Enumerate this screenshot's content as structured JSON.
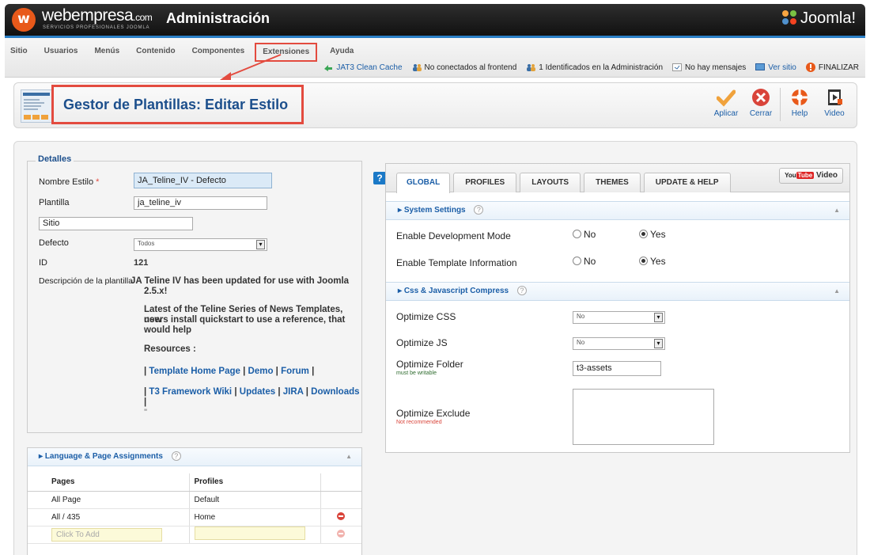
{
  "header": {
    "brand_name": "webempresa",
    "brand_domain": ".com",
    "brand_tagline": "SERVICIOS PROFESIONALES JOOMLA",
    "admin_title": "Administración",
    "joomla_logo": "Joomla!"
  },
  "menu": {
    "items": [
      "Sitio",
      "Usuarios",
      "Menús",
      "Contenido",
      "Componentes",
      "Extensiones",
      "Ayuda"
    ]
  },
  "status": {
    "cache": "JAT3 Clean Cache",
    "frontend": "No conectados al frontend",
    "admin": "1 Identificados en la Administración",
    "messages": "No hay mensajes",
    "view_site": "Ver sitio",
    "logout": "FINALIZAR"
  },
  "toolbar": {
    "title": "Gestor de Plantillas: Editar Estilo",
    "apply": "Aplicar",
    "close": "Cerrar",
    "help": "Help",
    "video": "Video"
  },
  "details": {
    "legend": "Detalles",
    "style_name_label": "Nombre Estilo",
    "required_mark": "*",
    "style_name_value": "JA_Teline_IV - Defecto",
    "template_label": "Plantilla",
    "template_value": "ja_teline_iv",
    "site_value": "Sitio",
    "default_label": "Defecto",
    "default_value": "Todos",
    "id_label": "ID",
    "id_value": "121",
    "desc_label": "Descripción de la plantilla",
    "desc_line1": "JA Teline IV has been updated for use with Joomla",
    "desc_line2": "2.5.x!",
    "desc_p2_line1": "Latest of the Teline Series of News Templates, new",
    "desc_p2_line2": "users install quickstart to use a reference, that",
    "desc_p2_line3": "would help",
    "resources": "Resources :",
    "links1": [
      "Template Home Page",
      "Demo",
      "Forum"
    ],
    "links2": [
      "T3 Framework Wiki",
      "Updates",
      "JIRA",
      "Downloads"
    ],
    "separator": "|",
    "trailing": "\""
  },
  "lang": {
    "title": "Language & Page Assignments",
    "help": "?",
    "col_pages": "Pages",
    "col_profiles": "Profiles",
    "rows": [
      {
        "page": "All Page",
        "profile": "Default"
      },
      {
        "page": "All / 435",
        "profile": "Home"
      }
    ],
    "add_placeholder": "Click To Add"
  },
  "tabs": {
    "help_box": "?",
    "items": [
      "GLOBAL",
      "PROFILES",
      "LAYOUTS",
      "THEMES",
      "UPDATE & HELP"
    ],
    "video_btn": "Video",
    "youtube_you": "You",
    "youtube_tube": "Tube"
  },
  "global": {
    "system_settings": "System Settings",
    "help": "?",
    "dev_mode_label": "Enable Development Mode",
    "tpl_info_label": "Enable Template Information",
    "no": "No",
    "yes": "Yes",
    "compress_title": "Css & Javascript Compress",
    "opt_css_label": "Optimize CSS",
    "opt_css_value": "No",
    "opt_js_label": "Optimize JS",
    "opt_js_value": "No",
    "opt_folder_label": "Optimize Folder",
    "opt_folder_note": "must be writable",
    "opt_folder_value": "t3-assets",
    "opt_exclude_label": "Optimize Exclude",
    "opt_exclude_note": "Not recommended"
  },
  "colors": {
    "accent_blue": "#1b5ea7",
    "highlight_red": "#e34b3f",
    "orange": "#e8591a"
  }
}
